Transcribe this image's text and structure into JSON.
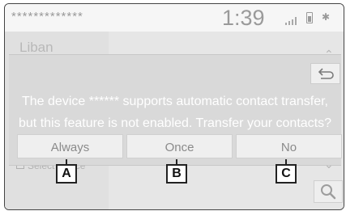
{
  "status_bar": {
    "device_name": "*************",
    "time": "1:39",
    "signal_icon": "signal-bars-icon",
    "battery_icon": "battery-icon",
    "bluetooth_icon": "bluetooth-icon"
  },
  "background": {
    "title": "Liban",
    "select_label": "Select device",
    "search_icon": "search-icon"
  },
  "dialog": {
    "back_icon": "return-arrow-icon",
    "message_line1": "The device ****** supports automatic contact transfer,",
    "message_line2": "but this feature is not enabled. Transfer your contacts?",
    "buttons": [
      "Always",
      "Once",
      "No"
    ]
  },
  "callouts": [
    "A",
    "B",
    "C"
  ]
}
